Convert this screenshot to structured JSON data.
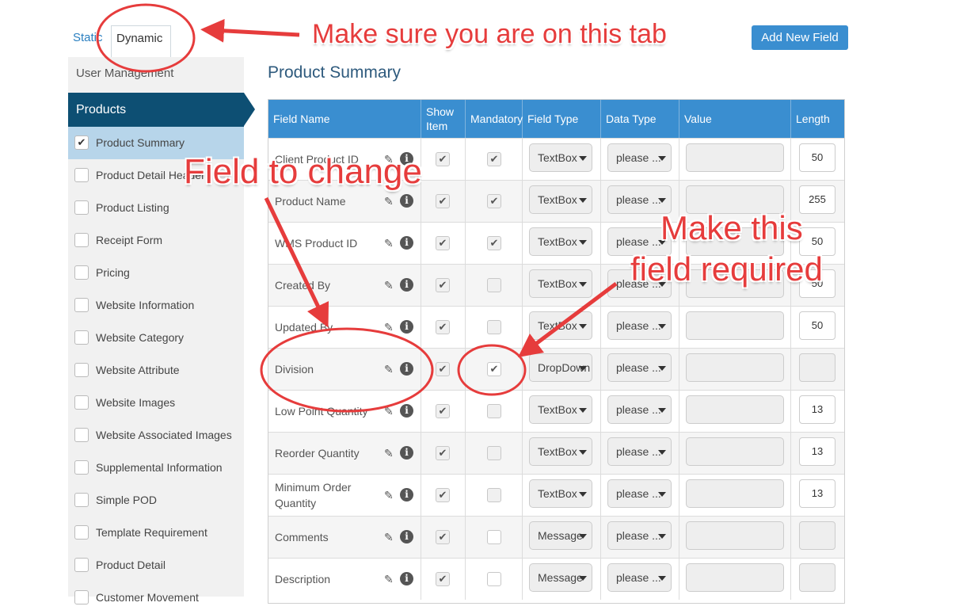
{
  "tabs": {
    "static": "Static",
    "dynamic": "Dynamic"
  },
  "add_button": "Add New Field",
  "sidebar": {
    "user_management": "User Management",
    "products": "Products",
    "items": [
      {
        "label": "Product Summary",
        "checked": true
      },
      {
        "label": "Product Detail Header",
        "checked": false
      },
      {
        "label": "Product Listing",
        "checked": false
      },
      {
        "label": "Receipt Form",
        "checked": false
      },
      {
        "label": "Pricing",
        "checked": false
      },
      {
        "label": "Website Information",
        "checked": false
      },
      {
        "label": "Website Category",
        "checked": false
      },
      {
        "label": "Website Attribute",
        "checked": false
      },
      {
        "label": "Website Images",
        "checked": false
      },
      {
        "label": "Website Associated Images",
        "checked": false
      },
      {
        "label": "Supplemental Information",
        "checked": false
      },
      {
        "label": "Simple POD",
        "checked": false
      },
      {
        "label": "Template Requirement",
        "checked": false
      },
      {
        "label": "Product Detail",
        "checked": false
      },
      {
        "label": "Customer Movement",
        "checked": false
      }
    ]
  },
  "page_title": "Product Summary",
  "table": {
    "headers": [
      "Field Name",
      "Show Item",
      "Mandatory",
      "Field Type",
      "Data Type",
      "Value",
      "Length"
    ],
    "rows": [
      {
        "name": "Client Product ID",
        "show": true,
        "mandatory": true,
        "mand_disabled": true,
        "type": "TextBox",
        "data_type": "please ...",
        "length": "50"
      },
      {
        "name": "Product Name",
        "show": true,
        "mandatory": true,
        "mand_disabled": true,
        "type": "TextBox",
        "data_type": "please ...",
        "length": "255"
      },
      {
        "name": "WMS Product ID",
        "show": true,
        "mandatory": true,
        "mand_disabled": true,
        "type": "TextBox",
        "data_type": "please ...",
        "length": "50"
      },
      {
        "name": "Created By",
        "show": true,
        "mandatory": false,
        "mand_disabled": true,
        "type": "TextBox",
        "data_type": "please ...",
        "length": "50"
      },
      {
        "name": "Updated By",
        "show": true,
        "mandatory": false,
        "mand_disabled": true,
        "type": "TextBox",
        "data_type": "please ...",
        "length": "50"
      },
      {
        "name": "Division",
        "show": true,
        "mandatory": true,
        "mand_disabled": false,
        "type": "DropDown",
        "data_type": "please ...",
        "length": ""
      },
      {
        "name": "Low Point Quantity",
        "show": true,
        "mandatory": false,
        "mand_disabled": true,
        "type": "TextBox",
        "data_type": "please ...",
        "length": "13"
      },
      {
        "name": "Reorder Quantity",
        "show": true,
        "mandatory": false,
        "mand_disabled": true,
        "type": "TextBox",
        "data_type": "please ...",
        "length": "13"
      },
      {
        "name": "Minimum Order Quantity",
        "show": true,
        "mandatory": false,
        "mand_disabled": true,
        "type": "TextBox",
        "data_type": "please ...",
        "length": "13"
      },
      {
        "name": "Comments",
        "show": true,
        "mandatory": false,
        "mand_disabled": false,
        "type": "Message",
        "data_type": "please ...",
        "length": ""
      },
      {
        "name": "Description",
        "show": true,
        "mandatory": false,
        "mand_disabled": false,
        "type": "Message",
        "data_type": "please ...",
        "length": ""
      }
    ]
  },
  "annotations": {
    "tab_note": "Make sure you are on this tab",
    "field_note": "Field to change",
    "required_note_line1": "Make this",
    "required_note_line2": "field required"
  },
  "colors": {
    "accent": "#3a8ed0",
    "nav_active": "#0d4f73",
    "annotation": "#e63c3c"
  }
}
